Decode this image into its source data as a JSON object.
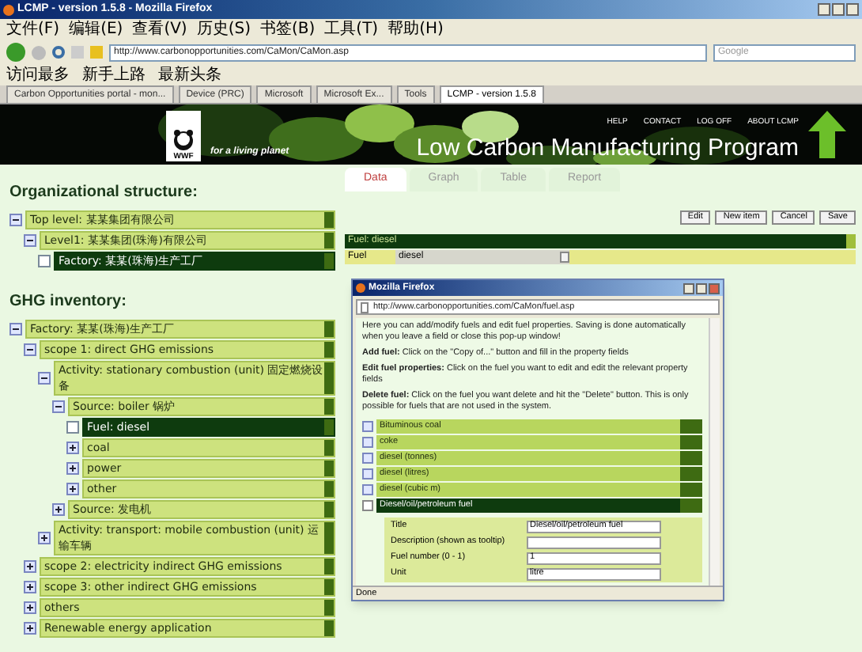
{
  "window": {
    "title": "LCMP - version 1.5.8 - Mozilla Firefox"
  },
  "menu": [
    "文件(F)",
    "编辑(E)",
    "查看(V)",
    "历史(S)",
    "书签(B)",
    "工具(T)",
    "帮助(H)"
  ],
  "address": {
    "url": "http://www.carbonopportunities.com/CaMon/CaMon.asp"
  },
  "search": {
    "placeholder": "Google"
  },
  "bookmarks": [
    "访问最多",
    "新手上路",
    "最新头条"
  ],
  "browser_tabs": [
    {
      "label": "Carbon Opportunities portal - mon...",
      "selected": false
    },
    {
      "label": "Device (PRC)",
      "selected": false
    },
    {
      "label": "Microsoft",
      "selected": false
    },
    {
      "label": "Microsoft Ex...",
      "selected": false
    },
    {
      "label": "Tools",
      "selected": false
    },
    {
      "label": "LCMP - version 1.5.8",
      "selected": true
    }
  ],
  "header": {
    "logo_text": "WWF",
    "tagline": "for a living planet",
    "links": [
      "HELP",
      "CONTACT",
      "LOG OFF",
      "ABOUT LCMP"
    ],
    "title": "Low Carbon Manufacturing Program"
  },
  "org": {
    "heading": "Organizational structure:",
    "tree": [
      {
        "label": "Top level: 某某集团有限公司",
        "expanded": true,
        "selected": false,
        "children": [
          {
            "label": "Level1: 某某集团(珠海)有限公司",
            "expanded": true,
            "selected": false,
            "children": [
              {
                "label": "Factory: 某某(珠海)生产工厂",
                "selected": true
              }
            ]
          }
        ]
      }
    ]
  },
  "ghg": {
    "heading": "GHG inventory:",
    "tree": [
      {
        "label": "Factory: 某某(珠海)生产工厂",
        "expanded": true,
        "selected": false,
        "children": [
          {
            "label": "scope 1: direct GHG emissions",
            "expanded": true,
            "selected": false,
            "children": [
              {
                "label": "Activity: stationary combustion (unit) 固定燃烧设备",
                "expanded": true,
                "selected": false,
                "children": [
                  {
                    "label": "Source: boiler 锅炉",
                    "expanded": true,
                    "selected": false,
                    "children": [
                      {
                        "label": "Fuel: diesel",
                        "selected": true
                      },
                      {
                        "label": "coal",
                        "expanded": false,
                        "selected": false
                      },
                      {
                        "label": "power",
                        "expanded": false,
                        "selected": false
                      },
                      {
                        "label": "other",
                        "expanded": false,
                        "selected": false
                      }
                    ]
                  },
                  {
                    "label": "Source: 发电机",
                    "expanded": false,
                    "selected": false
                  }
                ]
              },
              {
                "label": "Activity: transport: mobile combustion (unit) 运输车辆",
                "expanded": false,
                "selected": false
              }
            ]
          },
          {
            "label": "scope 2: electricity indirect GHG emissions",
            "expanded": false,
            "selected": false
          },
          {
            "label": "scope 3: other indirect GHG emissions",
            "expanded": false,
            "selected": false
          },
          {
            "label": "others",
            "expanded": false,
            "selected": false
          },
          {
            "label": "Renewable energy application",
            "expanded": false,
            "selected": false
          }
        ]
      }
    ]
  },
  "view_tabs": [
    {
      "label": "Data",
      "selected": true
    },
    {
      "label": "Graph",
      "selected": false
    },
    {
      "label": "Table",
      "selected": false
    },
    {
      "label": "Report",
      "selected": false
    }
  ],
  "actions": [
    "Edit",
    "New item",
    "Cancel",
    "Save"
  ],
  "record": {
    "title": "Fuel: diesel",
    "field_label": "Fuel",
    "field_value": "diesel"
  },
  "popup": {
    "title": "Mozilla Firefox",
    "url": "http://www.carbonopportunities.com/CaMon/fuel.asp",
    "paragraphs": [
      "Here you can add/modify fuels and edit fuel properties. Saving is done automatically when you leave a field or close this pop-up window!",
      "**Add fuel:** Click on the \"Copy of...\" button and fill in the property fields",
      "**Edit fuel properties:** Click on the fuel you want to edit and edit the relevant property fields",
      "**Delete fuel:** Click on the fuel you want delete and hit the \"Delete\" button. This is only possible for fuels that are not used in the system."
    ],
    "fuels": [
      {
        "label": "Bituminous coal",
        "selected": false
      },
      {
        "label": "coke",
        "selected": false
      },
      {
        "label": "diesel (tonnes)",
        "selected": false
      },
      {
        "label": "diesel (litres)",
        "selected": false
      },
      {
        "label": "diesel (cubic m)",
        "selected": false
      },
      {
        "label": "Diesel/oil/petroleum fuel",
        "selected": true
      }
    ],
    "fields": [
      {
        "label": "Title",
        "value": "Diesel/oil/petroleum fuel"
      },
      {
        "label": "Description (shown as tooltip)"
      },
      {
        "label": "Fuel number (0 - 1)",
        "value": "1"
      },
      {
        "label": "Unit",
        "value": "litre"
      }
    ],
    "status": "Done"
  }
}
